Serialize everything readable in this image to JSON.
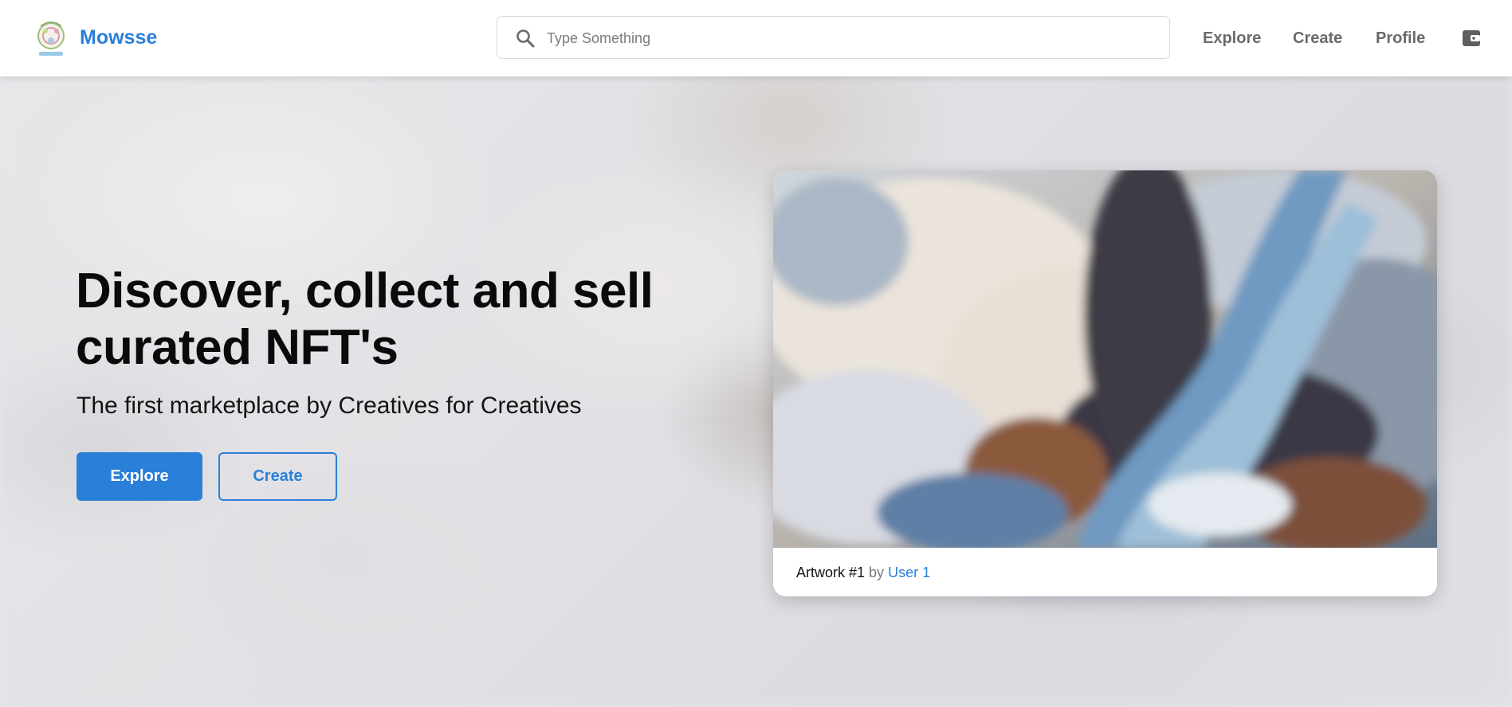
{
  "header": {
    "brand": "Mowsse",
    "search": {
      "placeholder": "Type Something"
    },
    "nav": {
      "explore": "Explore",
      "create": "Create",
      "profile": "Profile"
    },
    "icons": {
      "logo": "mowsse-logo",
      "search": "search-icon",
      "wallet": "wallet-icon"
    }
  },
  "hero": {
    "title": "Discover, collect and sell curated NFT's",
    "subtitle": "The first marketplace by Creatives for Creatives",
    "explore_button": "Explore",
    "create_button": "Create"
  },
  "featured": {
    "title": "Artwork #1",
    "by": "by",
    "user": "User 1"
  },
  "colors": {
    "accent": "#2a7fd9",
    "nav_text": "#6a6a6a",
    "heading": "#0a0a0a"
  }
}
